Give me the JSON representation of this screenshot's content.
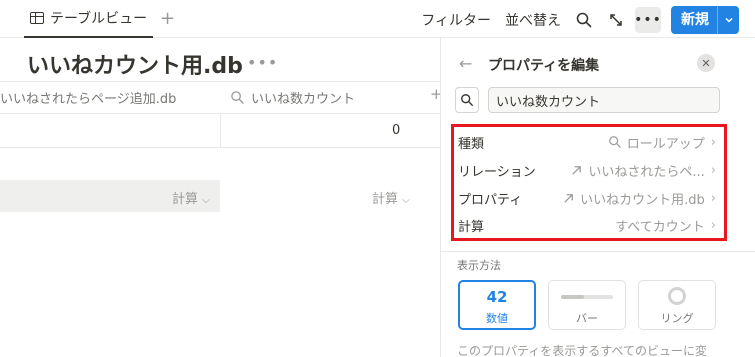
{
  "toolbar": {
    "view_tab_label": "テーブルビュー",
    "filter_label": "フィルター",
    "sort_label": "並べ替え",
    "new_label": "新規"
  },
  "database": {
    "title": "いいねカウント用.db",
    "columns": [
      {
        "label": "いいねされたらページ追加.db"
      },
      {
        "label": "いいね数カウント"
      }
    ],
    "rows": [
      {
        "value": "0"
      }
    ],
    "calc_labels": [
      "計算",
      "計算"
    ]
  },
  "panel": {
    "title": "プロパティを編集",
    "property_name": "いいね数カウント",
    "properties": [
      {
        "name": "種類",
        "value": "ロールアップ",
        "icon": "search-icon"
      },
      {
        "name": "リレーション",
        "value": "いいねされたらペ...",
        "icon": "arrow-up-right-icon"
      },
      {
        "name": "プロパティ",
        "value": "いいねカウント用.db",
        "icon": "arrow-up-right-icon"
      },
      {
        "name": "計算",
        "value": "すべてカウント",
        "icon": ""
      }
    ],
    "display_section_label": "表示方法",
    "display_options": [
      {
        "label": "数値",
        "preview": "42",
        "selected": true
      },
      {
        "label": "バー",
        "fill": 0.45,
        "selected": false
      },
      {
        "label": "リング",
        "selected": false
      }
    ],
    "footer_note": "このプロパティを表示するすべてのビューに変"
  },
  "colors": {
    "accent": "#2383e2",
    "highlight": "#e8171d"
  }
}
